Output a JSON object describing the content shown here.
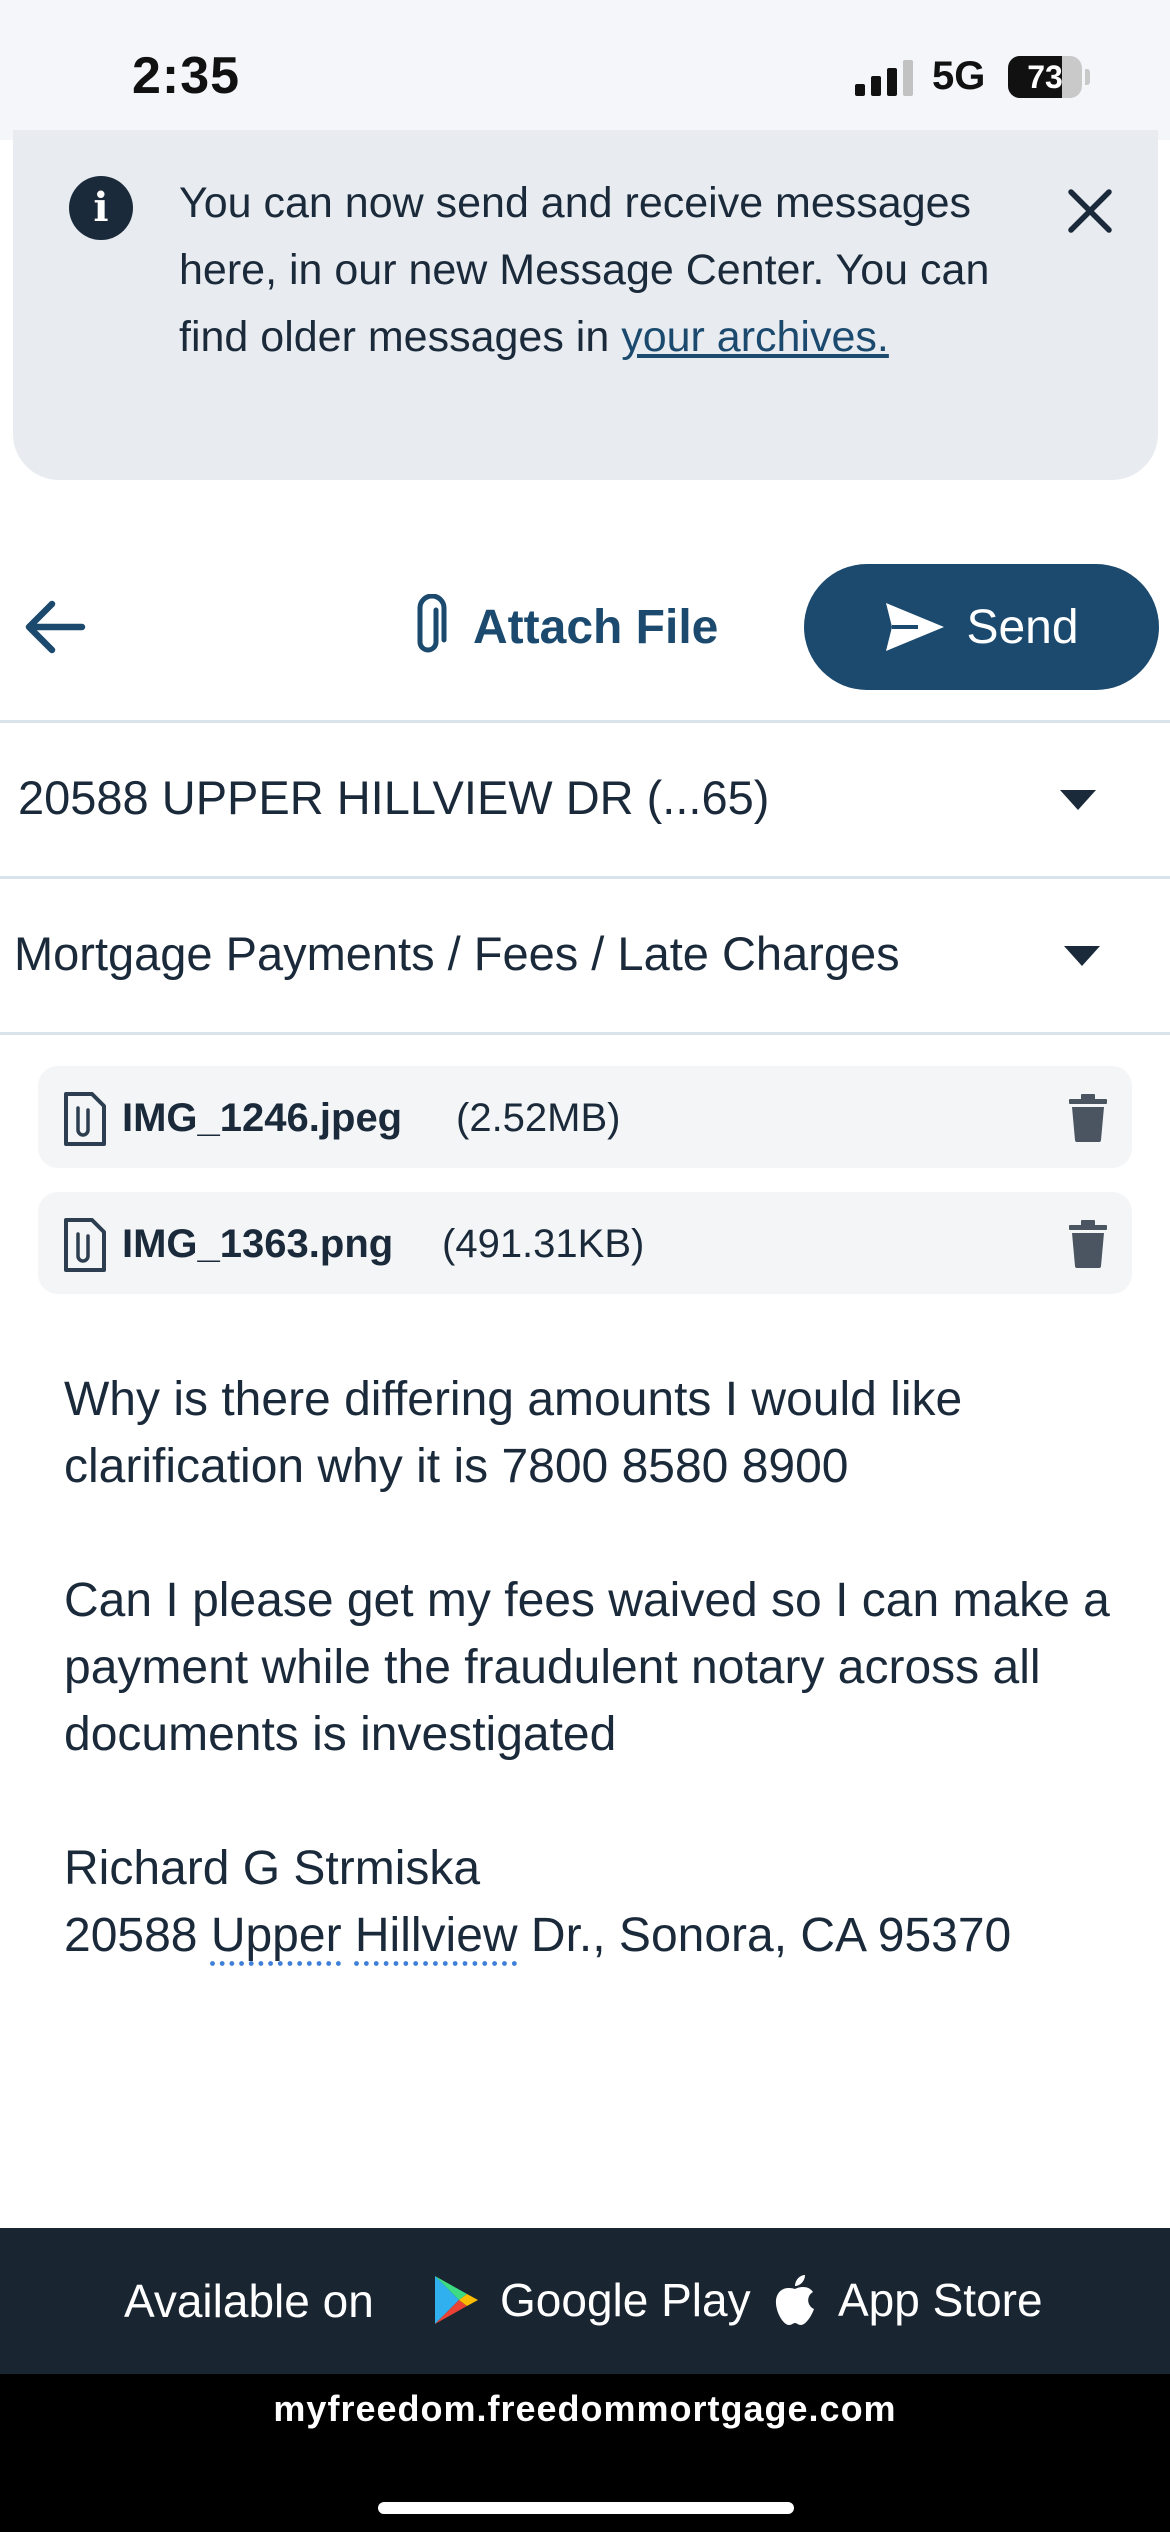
{
  "status_bar": {
    "time": "2:35",
    "network": "5G",
    "battery_percent": "73",
    "battery_level": 0.73
  },
  "banner": {
    "message": "You can now send and receive messages here, in our new Message Center. You can find older messages in ",
    "link_text": "your archives.",
    "icons": {
      "info": "info-icon",
      "close": "close-icon"
    }
  },
  "toolbar": {
    "back_icon": "arrow-left-icon",
    "attach_label": "Attach File",
    "attach_icon": "paperclip-icon",
    "send_label": "Send",
    "send_icon": "paper-plane-icon"
  },
  "property_select": {
    "value": "20588 UPPER HILLVIEW DR (...65)"
  },
  "topic_select": {
    "value": "Mortgage Payments / Fees / Late Charges"
  },
  "attachments": [
    {
      "name": "IMG_1246.jpeg",
      "size": "(2.52MB)"
    },
    {
      "name": "IMG_1363.png",
      "size": "(491.31KB)"
    }
  ],
  "message": {
    "paragraph1": "Why is there differing amounts I would like clarification why it is 7800 8580 8900",
    "paragraph2": "Can I please get my fees waived so I can make a payment while the fraudulent notary across all documents is investigated",
    "signature_name": "Richard G Strmiska",
    "signature_address": {
      "part1": "20588 ",
      "word1": "Upper",
      "part2": " ",
      "word2": "Hillview",
      "part3": " Dr., Sonora, CA 95370"
    }
  },
  "footer": {
    "available_on": "Available on",
    "google_play": "Google Play",
    "app_store": "App Store",
    "url": "myfreedom.freedommortgage.com"
  },
  "colors": {
    "primary": "#1b4a6e",
    "banner_bg": "#e8ecf0",
    "footer_bg": "#1a2532"
  }
}
